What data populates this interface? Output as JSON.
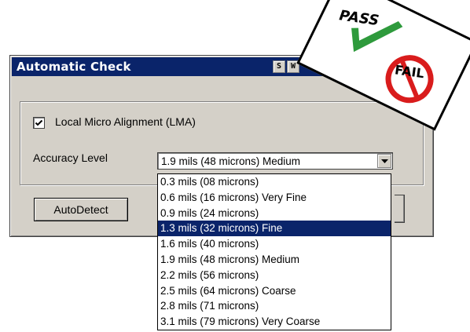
{
  "window": {
    "title": "Automatic Check",
    "title_buttons": [
      "S",
      "W"
    ]
  },
  "lma_checkbox": {
    "label": "Local Micro Alignment (LMA)",
    "checked": true
  },
  "accuracy": {
    "label": "Accuracy Level",
    "selected_value": "1.9 mils (48 microns) Medium",
    "options": [
      "0.3 mils (08 microns)",
      "0.6 mils (16 microns) Very Fine",
      "0.9 mils (24 microns)",
      "1.3 mils (32 microns) Fine",
      "1.6 mils (40 microns)",
      "1.9 mils (48 microns) Medium",
      "2.2 mils (56 microns)",
      "2.5 mils (64 microns) Coarse",
      "2.8 mils (71 microns)",
      "3.1 mils (79 microns) Very Coarse"
    ],
    "highlighted_index": 3
  },
  "buttons": {
    "autodetect": "AutoDetect"
  },
  "pass_fail_card": {
    "pass_text": "PASS",
    "fail_text": "FAIL",
    "check_color": "#2e9a3c",
    "fail_ring_color": "#d91c1c"
  },
  "colors": {
    "titlebar": "#0a246a",
    "dialog_face": "#d4d0c8",
    "selection": "#0a246a"
  }
}
